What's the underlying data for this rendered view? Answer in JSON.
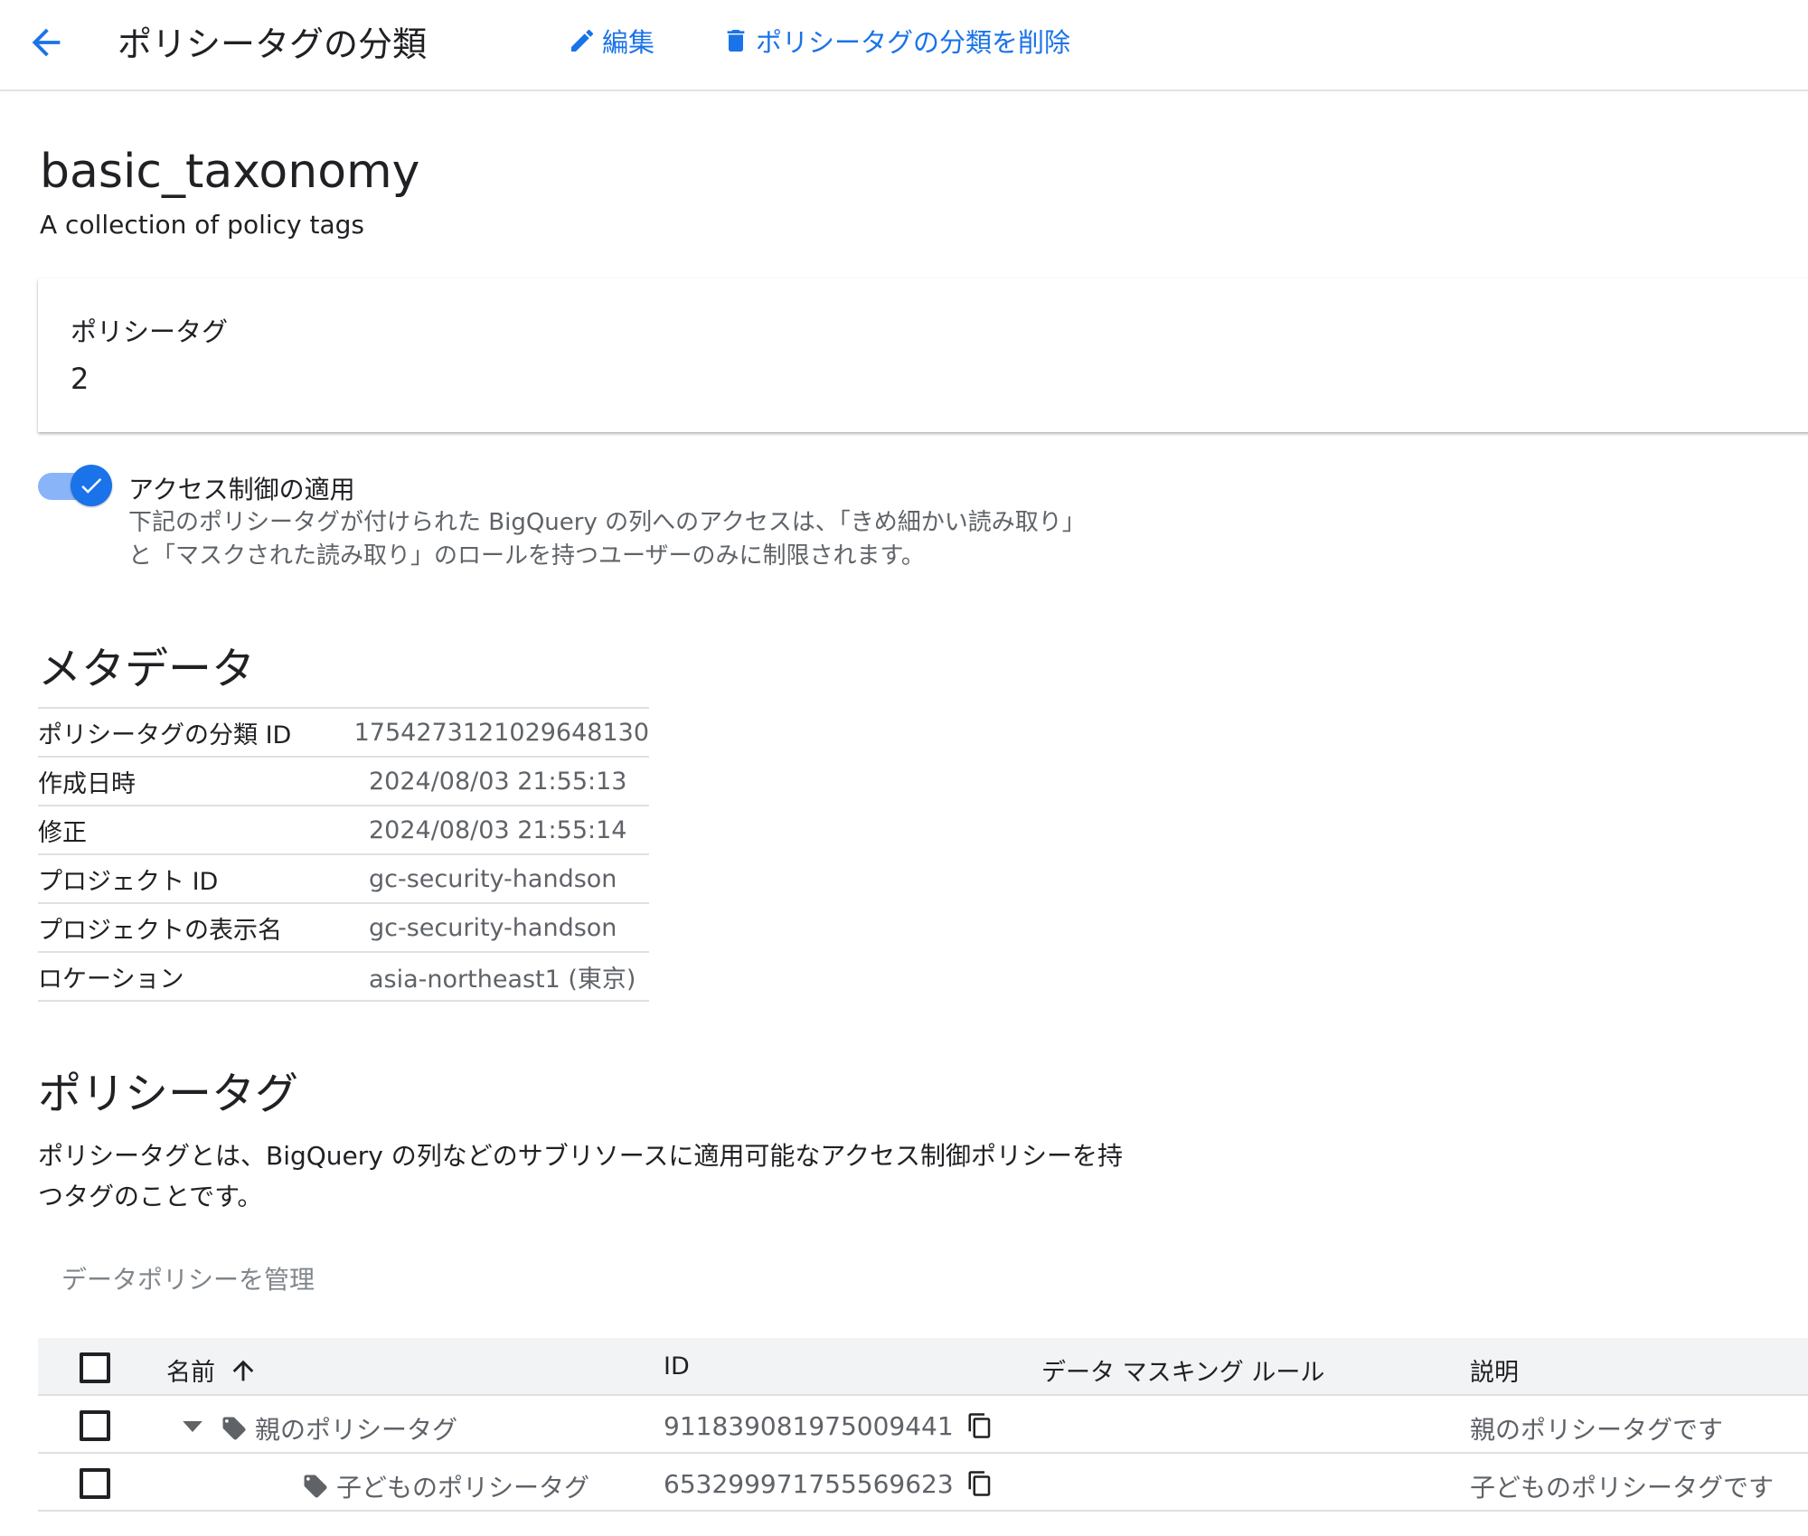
{
  "header": {
    "title": "ポリシータグの分類",
    "edit_label": "編集",
    "delete_label": "ポリシータグの分類を削除"
  },
  "taxonomy": {
    "name": "basic_taxonomy",
    "description": "A collection of policy tags"
  },
  "card": {
    "label": "ポリシータグ",
    "value": "2"
  },
  "access_control": {
    "enabled": true,
    "label": "アクセス制御の適用",
    "description": "下記のポリシータグが付けられた BigQuery の列へのアクセスは、「きめ細かい読み取り」と「マスクされた読み取り」のロールを持つユーザーのみに制限されます。"
  },
  "metadata": {
    "title": "メタデータ",
    "rows": [
      {
        "key": "ポリシータグの分類 ID",
        "value": "1754273121029648130"
      },
      {
        "key": "作成日時",
        "value": "2024/08/03 21:55:13"
      },
      {
        "key": "修正",
        "value": "2024/08/03 21:55:14"
      },
      {
        "key": "プロジェクト ID",
        "value": "gc-security-handson"
      },
      {
        "key": "プロジェクトの表示名",
        "value": "gc-security-handson"
      },
      {
        "key": "ロケーション",
        "value": "asia-northeast1 (東京)"
      }
    ]
  },
  "policy_tags": {
    "title": "ポリシータグ",
    "description": "ポリシータグとは、BigQuery の列などのサブリソースに適用可能なアクセス制御ポリシーを持つタグのことです。",
    "manage_label": "データポリシーを管理",
    "columns": {
      "name": "名前",
      "id": "ID",
      "masking": "データ マスキング ルール",
      "description": "説明"
    },
    "rows": [
      {
        "name": "親のポリシータグ",
        "id": "911839081975009441",
        "masking": "",
        "description": "親のポリシータグです"
      },
      {
        "name": "子どものポリシータグ",
        "id": "653299971755569623",
        "masking": "",
        "description": "子どものポリシータグです"
      }
    ]
  },
  "colors": {
    "accent": "#1a73e8",
    "accent_light": "#8ab4f8",
    "muted_text": "#5f6368",
    "header_bg": "#f1f3f4"
  },
  "icons": {
    "back": "arrow-left-icon",
    "edit": "pencil-icon",
    "delete": "trash-icon",
    "sort": "arrow-up-icon",
    "expand": "caret-down-icon",
    "tag": "tag-icon",
    "copy": "copy-icon"
  }
}
